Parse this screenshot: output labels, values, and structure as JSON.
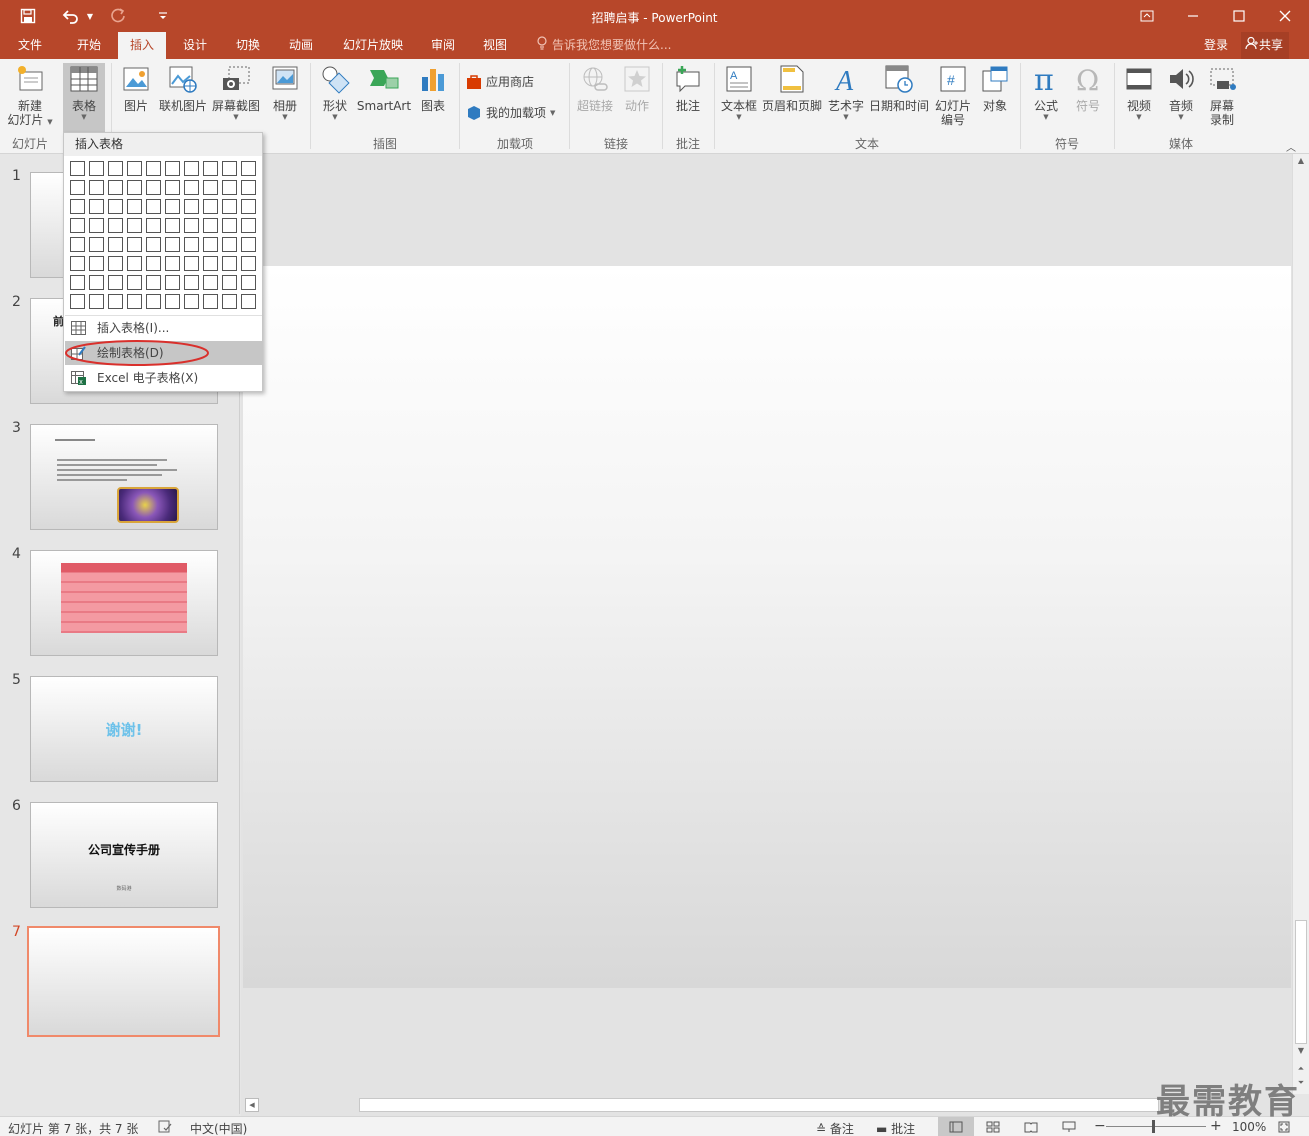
{
  "window": {
    "title": "招聘启事 - PowerPoint"
  },
  "quick_access": {
    "save_icon": "save-icon",
    "undo_icon": "undo-icon",
    "redo_icon": "redo-icon",
    "customize_icon": "customize-icon"
  },
  "window_controls": {
    "ribbon_display": "ribbon-display-icon",
    "minimize": "minimize-icon",
    "maximize": "maximize-icon",
    "close": "close-icon"
  },
  "menu": {
    "tabs": [
      {
        "label": "文件"
      },
      {
        "label": "开始"
      },
      {
        "label": "插入",
        "active": true
      },
      {
        "label": "设计"
      },
      {
        "label": "切换"
      },
      {
        "label": "动画"
      },
      {
        "label": "幻灯片放映"
      },
      {
        "label": "审阅"
      },
      {
        "label": "视图"
      }
    ],
    "tell_me": "告诉我您想要做什么...",
    "login": "登录",
    "share": "共享"
  },
  "ribbon": {
    "new_slide": "新建",
    "new_slide_2": "幻灯片",
    "table": "表格",
    "picture": "图片",
    "online_picture": "联机图片",
    "screenshot": "屏幕截图",
    "album": "相册",
    "shapes": "形状",
    "smartart": "SmartArt",
    "chart": "图表",
    "app_store": "应用商店",
    "my_addins": "我的加载项",
    "hyperlink": "超链接",
    "action": "动作",
    "comment": "批注",
    "textbox": "文本框",
    "header_footer": "页眉和页脚",
    "wordart": "艺术字",
    "datetime": "日期和时间",
    "slide_number": "幻灯片",
    "slide_number_2": "编号",
    "object": "对象",
    "equation": "公式",
    "symbol": "符号",
    "video": "视频",
    "audio": "音频",
    "screen_record": "屏幕",
    "screen_record_2": "录制",
    "groups": {
      "slides": "幻灯片",
      "illustrations": "插图",
      "addins": "加载项",
      "links": "链接",
      "comments": "批注",
      "text": "文本",
      "symbols": "符号",
      "media": "媒体"
    }
  },
  "dropdown": {
    "header": "插入表格",
    "grid_cols": 10,
    "grid_rows": 8,
    "items": [
      {
        "label": "插入表格(I)..."
      },
      {
        "label": "绘制表格(D)",
        "highlighted": true
      },
      {
        "label": "Excel 电子表格(X)"
      }
    ]
  },
  "slides": [
    {
      "number": "1"
    },
    {
      "number": "2",
      "text": "前"
    },
    {
      "number": "3"
    },
    {
      "number": "4"
    },
    {
      "number": "5",
      "text": "谢谢!"
    },
    {
      "number": "6",
      "title": "公司宣传手册",
      "subtitle": "数码港"
    },
    {
      "number": "7",
      "selected": true
    }
  ],
  "status": {
    "slide_info": "幻灯片 第 7 张，共 7 张",
    "language": "中文(中国)",
    "notes": "备注",
    "comments": "批注",
    "zoom": "100%"
  },
  "watermark": "最需教育",
  "colors": {
    "accent": "#b7472a",
    "selection": "#f0896a",
    "highlight_circle": "#d9302c"
  }
}
